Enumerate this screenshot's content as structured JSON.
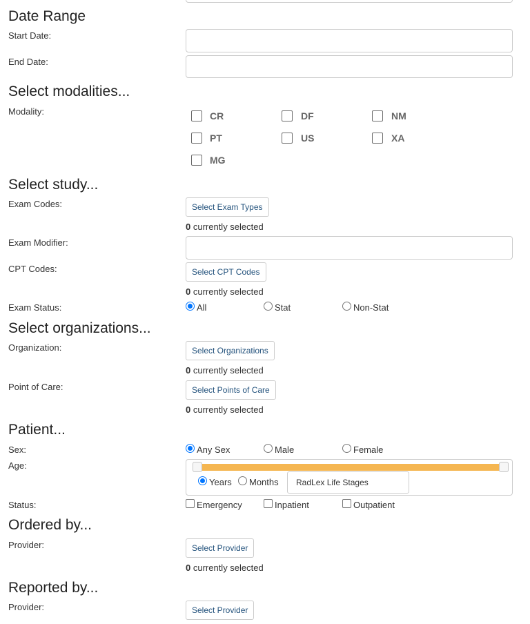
{
  "date_range": {
    "heading": "Date Range",
    "start_label": "Start Date:",
    "end_label": "End Date:"
  },
  "modalities": {
    "heading": "Select modalities...",
    "label": "Modality:",
    "items": [
      {
        "code": "CR",
        "checked": false
      },
      {
        "code": "DF",
        "checked": false
      },
      {
        "code": "NM",
        "checked": false
      },
      {
        "code": "PT",
        "checked": false
      },
      {
        "code": "US",
        "checked": false
      },
      {
        "code": "XA",
        "checked": false
      },
      {
        "code": "MG",
        "checked": false
      }
    ]
  },
  "study": {
    "heading": "Select study...",
    "exam_codes_label": "Exam Codes:",
    "exam_types_button": "Select Exam Types",
    "exam_codes_count": "0",
    "count_suffix": " currently selected",
    "exam_modifier_label": "Exam Modifier:",
    "cpt_label": "CPT Codes:",
    "cpt_button": "Select CPT Codes",
    "cpt_count": "0",
    "exam_status_label": "Exam Status:",
    "status_options": [
      {
        "label": "All",
        "selected": true
      },
      {
        "label": "Stat",
        "selected": false
      },
      {
        "label": "Non-Stat",
        "selected": false
      }
    ]
  },
  "organizations": {
    "heading": "Select organizations...",
    "org_label": "Organization:",
    "org_button": "Select Organizations",
    "org_count": "0",
    "poc_label": "Point of Care:",
    "poc_button": "Select Points of Care",
    "poc_count": "0"
  },
  "patient": {
    "heading": "Patient...",
    "sex_label": "Sex:",
    "sex_options": [
      {
        "label": "Any Sex",
        "selected": true
      },
      {
        "label": "Male",
        "selected": false
      },
      {
        "label": "Female",
        "selected": false
      }
    ],
    "age_label": "Age:",
    "age_range_fraction": [
      0,
      1
    ],
    "age_units": [
      {
        "label": "Years",
        "selected": true
      },
      {
        "label": "Months",
        "selected": false
      }
    ],
    "life_stages_button": "RadLex Life Stages",
    "status_label": "Status:",
    "status_options": [
      {
        "label": "Emergency",
        "checked": false
      },
      {
        "label": "Inpatient",
        "checked": false
      },
      {
        "label": "Outpatient",
        "checked": false
      }
    ]
  },
  "ordered_by": {
    "heading": "Ordered by...",
    "provider_label": "Provider:",
    "provider_button": "Select Provider",
    "provider_count": "0"
  },
  "reported_by": {
    "heading": "Reported by...",
    "provider_label": "Provider:",
    "provider_button": "Select Provider"
  },
  "colors": {
    "slider_fill": "#f5b651",
    "radio_accent": "#0075ff",
    "button_text": "#23527c"
  }
}
